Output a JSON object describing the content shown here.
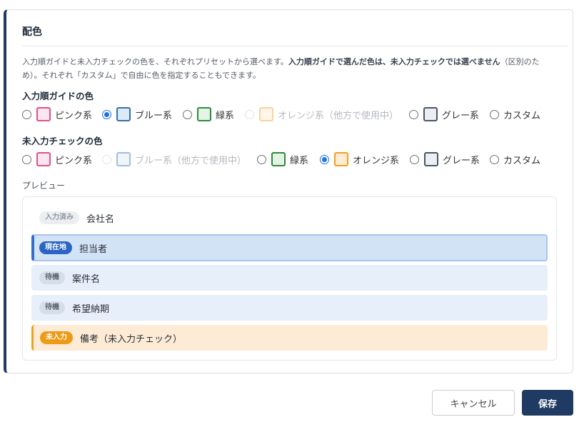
{
  "dialog": {
    "title": "配色",
    "description": {
      "part1": "入力順ガイドと未入力チェックの色を、それぞれプリセットから選べます。",
      "bold": "入力順ガイドで選んだ色は、未入力チェックでは選べません",
      "part2": "（区別のため）。それぞれ「カスタム」で自由に色を指定することもできます。"
    }
  },
  "guide_color": {
    "label": "入力順ガイドの色",
    "options": [
      {
        "label": "ピンク系",
        "state": "unchecked",
        "swatch_border": "#e0508c",
        "swatch_fill": "#fde6ef"
      },
      {
        "label": "ブルー系",
        "state": "checked",
        "swatch_border": "#3a6fa8",
        "swatch_fill": "#dce9f7"
      },
      {
        "label": "緑系",
        "state": "unchecked",
        "swatch_border": "#2e8b3a",
        "swatch_fill": "#e3f3e5"
      },
      {
        "label": "オレンジ系（他方で使用中）",
        "state": "disabled",
        "swatch_border": "#f0a021",
        "swatch_fill": "#fdebd5"
      },
      {
        "label": "グレー系",
        "state": "unchecked",
        "swatch_border": "#4b5563",
        "swatch_fill": "#eceef1"
      },
      {
        "label": "カスタム",
        "state": "unchecked"
      }
    ]
  },
  "missing_color": {
    "label": "未入力チェックの色",
    "options": [
      {
        "label": "ピンク系",
        "state": "unchecked",
        "swatch_border": "#e0508c",
        "swatch_fill": "#fde6ef"
      },
      {
        "label": "ブルー系（他方で使用中）",
        "state": "disabled",
        "swatch_border": "#3a6fa8",
        "swatch_fill": "#dce9f7"
      },
      {
        "label": "緑系",
        "state": "unchecked",
        "swatch_border": "#2e8b3a",
        "swatch_fill": "#e3f3e5"
      },
      {
        "label": "オレンジ系",
        "state": "checked",
        "swatch_border": "#f0a021",
        "swatch_fill": "#fdebd5"
      },
      {
        "label": "グレー系",
        "state": "unchecked",
        "swatch_border": "#4b5563",
        "swatch_fill": "#eceef1"
      },
      {
        "label": "カスタム",
        "state": "unchecked"
      }
    ]
  },
  "preview": {
    "label": "プレビュー",
    "rows": [
      {
        "badge": "入力済み",
        "text": "会社名"
      },
      {
        "badge": "現在地",
        "text": "担当者"
      },
      {
        "badge": "待機",
        "text": "案件名"
      },
      {
        "badge": "待機",
        "text": "希望納期"
      },
      {
        "badge": "未入力",
        "text": "備考（未入力チェック）"
      }
    ]
  },
  "buttons": {
    "cancel": "キャンセル",
    "save": "保存"
  },
  "colors": {
    "accent": "#1f3a63",
    "radio_checked": "#1a73e8",
    "current_row": "#d3e3f6",
    "missing_row": "#fdebd5"
  }
}
